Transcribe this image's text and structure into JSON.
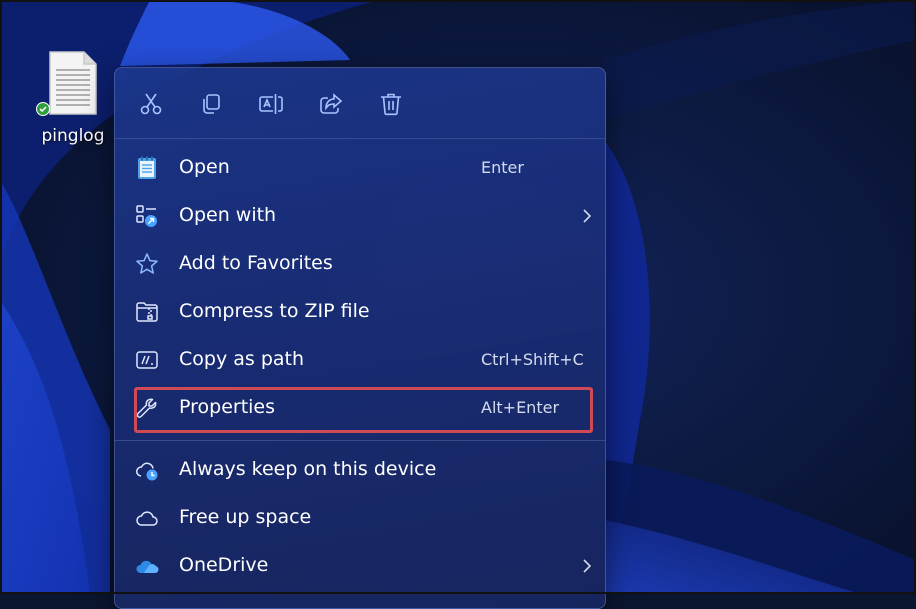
{
  "desktop": {
    "icons": [
      {
        "label": "pinglog",
        "icon": "document-file-icon",
        "status_icon": "synced-check-icon"
      }
    ]
  },
  "toolbar": [
    {
      "name": "cut-button",
      "icon": "scissors-icon"
    },
    {
      "name": "copy-button",
      "icon": "copy-icon"
    },
    {
      "name": "rename-button",
      "icon": "rename-icon"
    },
    {
      "name": "share-button",
      "icon": "share-icon"
    },
    {
      "name": "delete-button",
      "icon": "trash-icon"
    }
  ],
  "menu": {
    "items": [
      {
        "label": "Open",
        "shortcut": "Enter",
        "icon": "notepad-icon"
      },
      {
        "label": "Open with",
        "shortcut": "",
        "icon": "open-with-icon",
        "submenu": true
      },
      {
        "label": "Add to Favorites",
        "shortcut": "",
        "icon": "star-icon"
      },
      {
        "label": "Compress to ZIP file",
        "shortcut": "",
        "icon": "zip-folder-icon"
      },
      {
        "label": "Copy as path",
        "shortcut": "Ctrl+Shift+C",
        "icon": "copy-path-icon"
      },
      {
        "label": "Properties",
        "shortcut": "Alt+Enter",
        "icon": "wrench-icon",
        "highlighted": true
      },
      {
        "label": "Always keep on this device",
        "shortcut": "",
        "icon": "cloud-sync-icon"
      },
      {
        "label": "Free up space",
        "shortcut": "",
        "icon": "cloud-icon"
      },
      {
        "label": "OneDrive",
        "shortcut": "",
        "icon": "onedrive-icon",
        "submenu": true
      }
    ]
  },
  "colors": {
    "menu_bg": "#1c3a8c",
    "highlight_border": "#d04a55",
    "accent": "#4aa3ff"
  }
}
